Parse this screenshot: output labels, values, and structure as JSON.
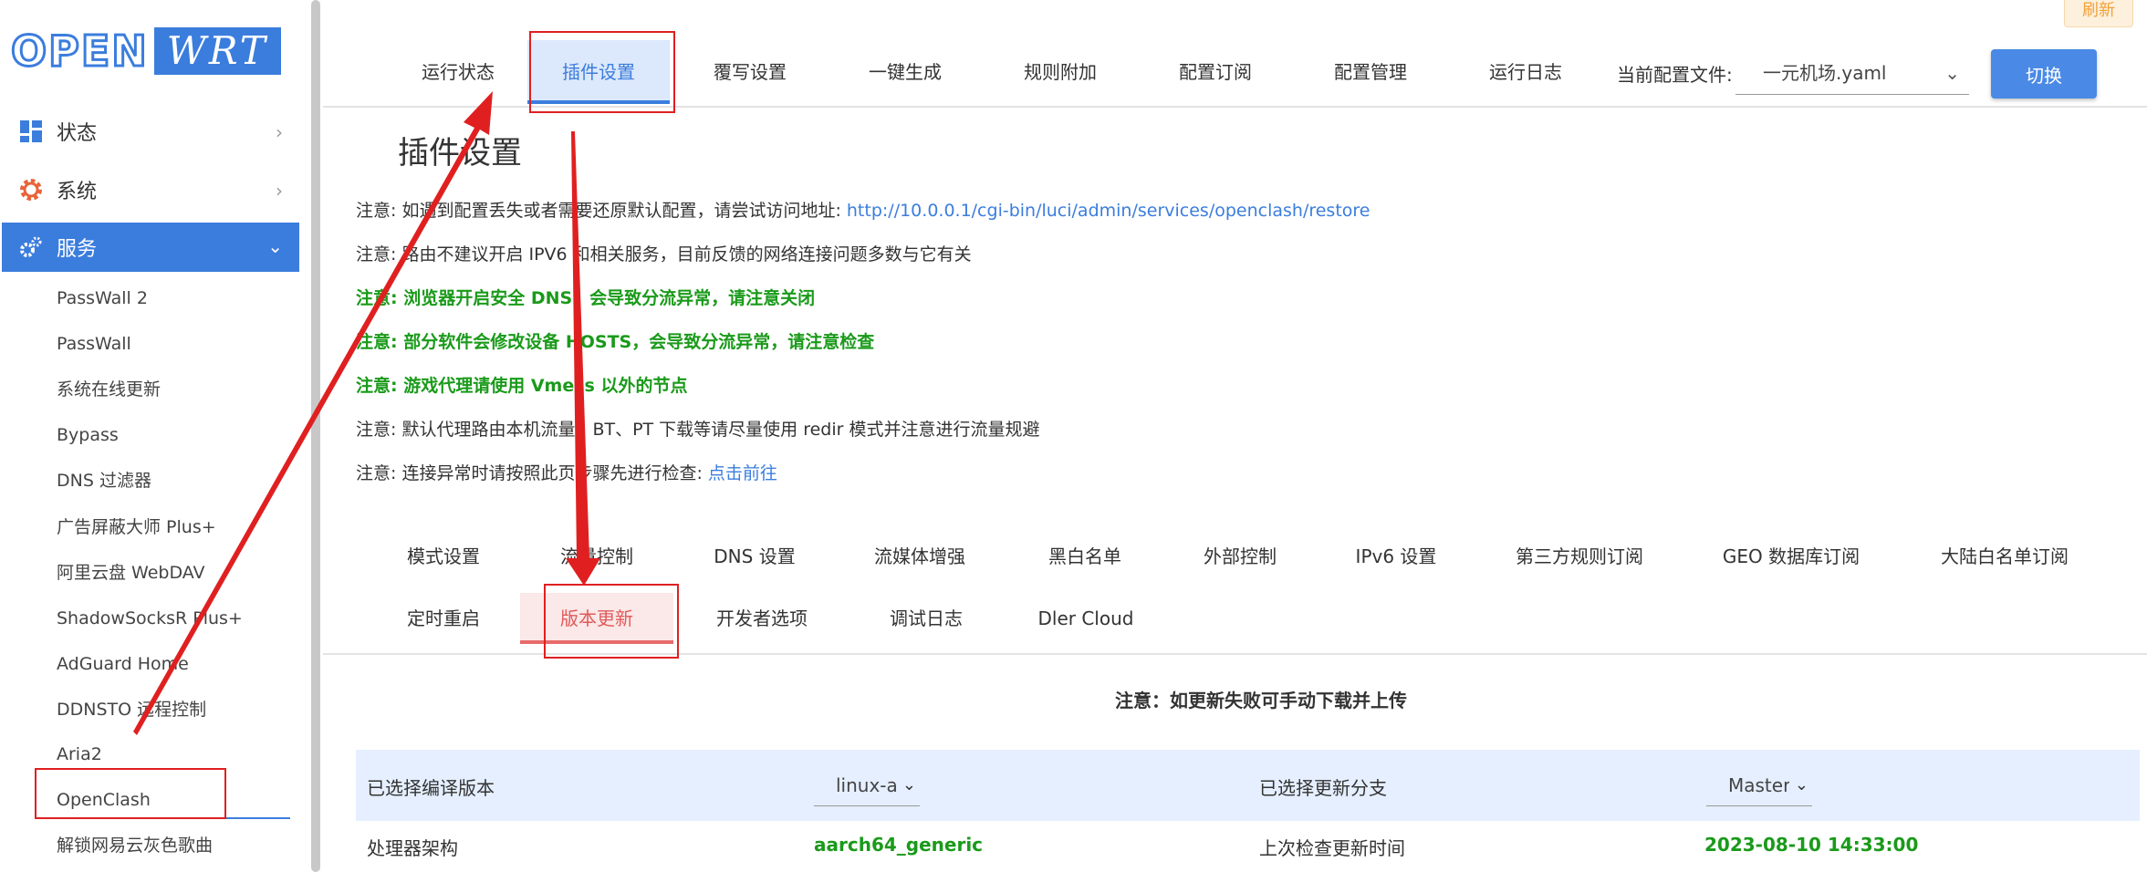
{
  "logo": {
    "part1": "OPEN",
    "part2": "WRT"
  },
  "sidebar": {
    "main_items": [
      {
        "label": "状态",
        "icon": "dashboard-icon"
      },
      {
        "label": "系统",
        "icon": "gear-icon"
      },
      {
        "label": "服务",
        "icon": "gears-icon",
        "active": true
      }
    ],
    "sub_items": [
      "PassWall 2",
      "PassWall",
      "系统在线更新",
      "Bypass",
      "DNS 过滤器",
      "广告屏蔽大师 Plus+",
      "阿里云盘 WebDAV",
      "ShadowSocksR Plus+",
      "AdGuard Home",
      "DDNSTO 远程控制",
      "Aria2",
      "OpenClash",
      "解锁网易云灰色歌曲"
    ]
  },
  "top_tabs": [
    "运行状态",
    "插件设置",
    "覆写设置",
    "一键生成",
    "规则附加",
    "配置订阅",
    "配置管理",
    "运行日志"
  ],
  "config": {
    "label": "当前配置文件:",
    "value": "一元机场.yaml",
    "switch_label": "切换",
    "refresh_label": "刷新"
  },
  "page_title": "插件设置",
  "notes": {
    "n1_text": "注意: 如遇到配置丢失或者需要还原默认配置，请尝试访问地址: ",
    "n1_link": "http://10.0.0.1/cgi-bin/luci/admin/services/openclash/restore",
    "n2": "注意: 路由不建议开启 IPV6 和相关服务，目前反馈的网络连接问题多数与它有关",
    "n3": "注意: 浏览器开启安全 DNS，会导致分流异常，请注意关闭",
    "n4": "注意: 部分软件会修改设备 HOSTS，会导致分流异常，请注意检查",
    "n5": "注意: 游戏代理请使用 Vmess 以外的节点",
    "n6": "注意: 默认代理路由本机流量，BT、PT 下载等请尽量使用 redir 模式并注意进行流量规避",
    "n7_text": "注意: 连接异常时请按照此页步骤先进行检查: ",
    "n7_link": "点击前往"
  },
  "sub_tabs_row1": [
    "模式设置",
    "流量控制",
    "DNS 设置",
    "流媒体增强",
    "黑白名单",
    "外部控制",
    "IPv6 设置",
    "第三方规则订阅",
    "GEO 数据库订阅",
    "大陆白名单订阅"
  ],
  "sub_tabs_row2": [
    "定时重启",
    "版本更新",
    "开发者选项",
    "调试日志",
    "Dler Cloud"
  ],
  "update_note": "注意：如更新失败可手动下载并上传",
  "update_table": {
    "row1": {
      "label1": "已选择编译版本",
      "value1": "linux-a",
      "label2": "已选择更新分支",
      "value2": "Master"
    },
    "row2": {
      "label1": "处理器架构",
      "value1": "aarch64_generic",
      "label2": "上次检查更新时间",
      "value2": "2023-08-10 14:33:00"
    }
  },
  "colors": {
    "accent": "#3b7ddd",
    "note_green": "#1a9a1a",
    "annotation_red": "#e02020",
    "active_subtab": "#e05a5a"
  }
}
